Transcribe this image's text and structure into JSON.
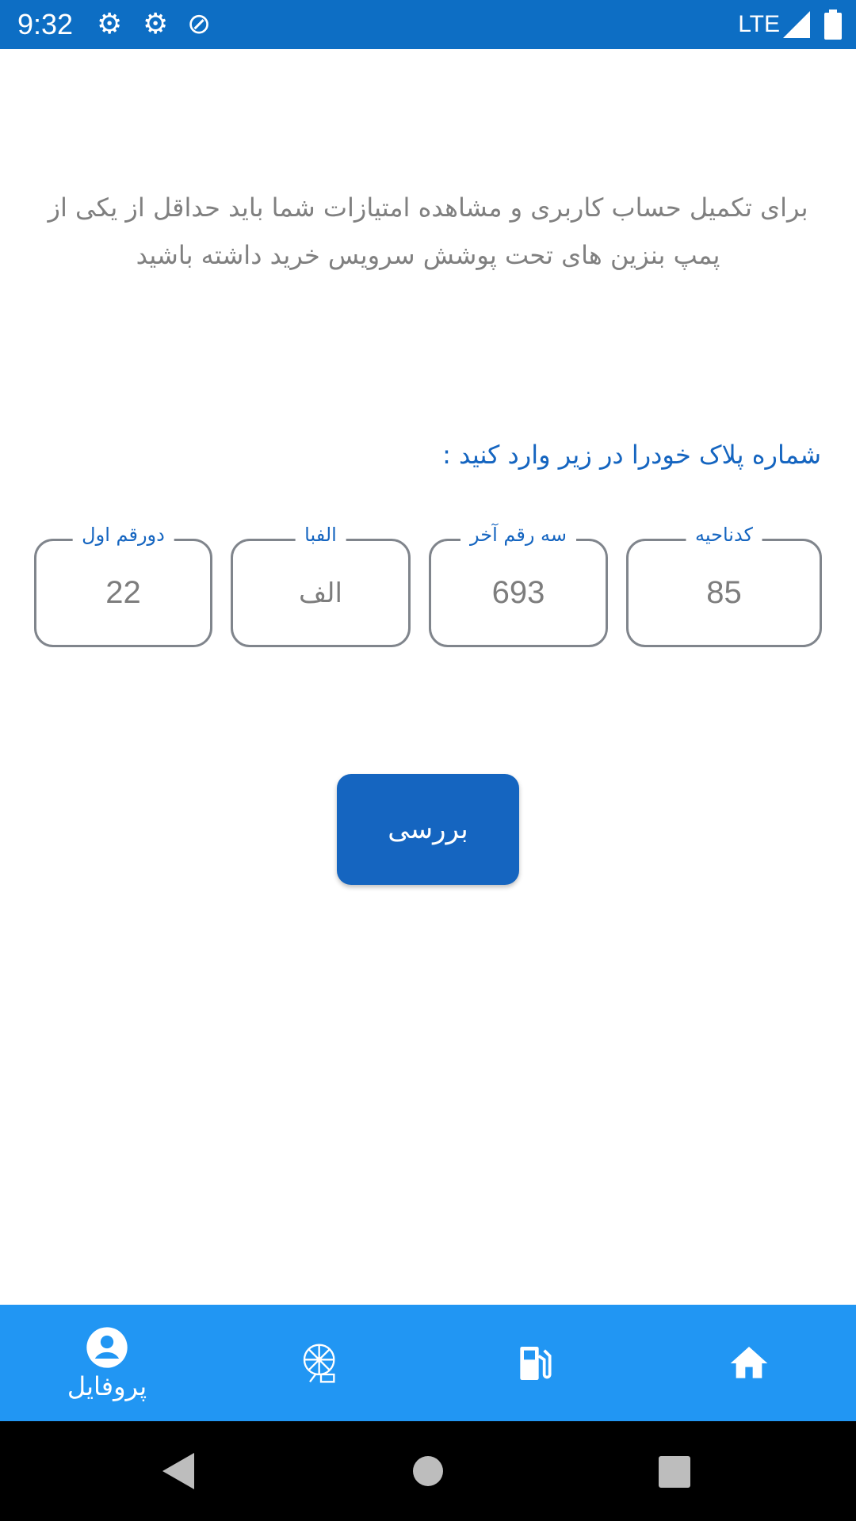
{
  "status_bar": {
    "time": "9:32",
    "network": "LTE",
    "icons": [
      "settings-icon",
      "settings-icon",
      "data-saver-icon",
      "signal-icon",
      "battery-icon"
    ]
  },
  "info_text": "برای تکمیل حساب کاربری و مشاهده امتیازات شما باید حداقل از یکی از پمپ بنزین های تحت پوشش سرویس خرید داشته باشید",
  "prompt": "شماره پلاک خودرا در زیر وارد کنید :",
  "plate_fields": [
    {
      "label": "کدناحیه",
      "value": "85"
    },
    {
      "label": "سه رقم آخر",
      "value": "693"
    },
    {
      "label": "الفبا",
      "value": "الف"
    },
    {
      "label": "دورقم اول",
      "value": "22"
    }
  ],
  "check_button": "بررسی",
  "bottom_nav": {
    "items": [
      {
        "icon": "profile-icon",
        "label": "پروفایل",
        "active": true
      },
      {
        "icon": "ferris-wheel-icon"
      },
      {
        "icon": "gas-station-icon"
      },
      {
        "icon": "home-icon"
      }
    ],
    "color": "#2196F3"
  }
}
